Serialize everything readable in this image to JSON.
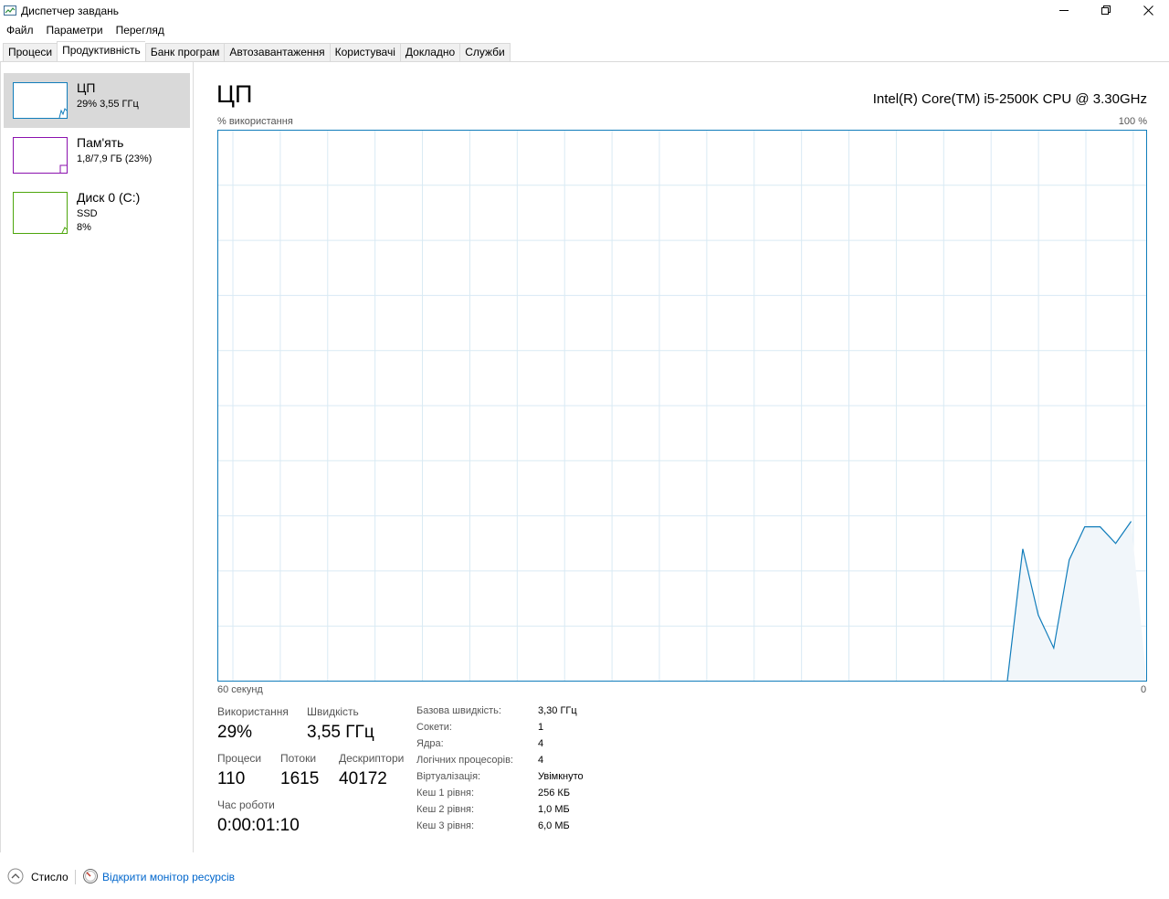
{
  "window": {
    "title": "Диспетчер завдань"
  },
  "menu": [
    "Файл",
    "Параметри",
    "Перегляд"
  ],
  "tabs": [
    "Процеси",
    "Продуктивність",
    "Банк програм",
    "Автозавантаження",
    "Користувачі",
    "Докладно",
    "Служби"
  ],
  "active_tab": "Продуктивність",
  "sidebar": {
    "items": [
      {
        "title": "ЦП",
        "line1": "29%  3,55 ГГц",
        "line2": ""
      },
      {
        "title": "Пам'ять",
        "line1": "1,8/7,9 ГБ (23%)",
        "line2": ""
      },
      {
        "title": "Диск 0 (C:)",
        "line1": "SSD",
        "line2": "8%"
      }
    ]
  },
  "main": {
    "title": "ЦП",
    "cpu_model": "Intel(R) Core(TM) i5-2500K CPU @ 3.30GHz",
    "y_axis_label": "% використання",
    "y_axis_max": "100 %",
    "x_axis_left": "60 секунд",
    "x_axis_right": "0"
  },
  "chart_data": {
    "type": "area",
    "x": [
      0,
      1,
      2,
      3,
      4,
      5,
      6,
      7,
      8,
      9,
      10,
      11,
      12,
      13,
      14,
      15,
      16,
      17,
      18,
      19,
      20,
      21,
      22,
      23,
      24,
      25,
      26,
      27,
      28,
      29,
      30,
      31,
      32,
      33,
      34,
      35,
      36,
      37,
      38,
      39,
      40,
      41,
      42,
      43,
      44,
      45,
      46,
      47,
      48,
      49,
      50,
      51,
      52,
      53,
      54,
      55,
      56,
      57,
      58,
      59,
      60
    ],
    "values": [
      0,
      0,
      0,
      0,
      0,
      0,
      0,
      0,
      0,
      0,
      0,
      0,
      0,
      0,
      0,
      0,
      0,
      0,
      0,
      0,
      0,
      0,
      0,
      0,
      0,
      0,
      0,
      0,
      0,
      0,
      0,
      0,
      0,
      0,
      0,
      0,
      0,
      0,
      0,
      0,
      0,
      0,
      0,
      0,
      0,
      0,
      0,
      0,
      0,
      0,
      0,
      0,
      24,
      12,
      6,
      22,
      28,
      28,
      25,
      29
    ],
    "ylim": [
      0,
      100
    ],
    "grid": true
  },
  "stats": {
    "usage_label": "Використання",
    "usage_value": "29%",
    "speed_label": "Швидкість",
    "speed_value": "3,55 ГГц",
    "processes_label": "Процеси",
    "processes_value": "110",
    "threads_label": "Потоки",
    "threads_value": "1615",
    "handles_label": "Дескриптори",
    "handles_value": "40172",
    "uptime_label": "Час роботи",
    "uptime_value": "0:00:01:10"
  },
  "specs": [
    {
      "label": "Базова швидкість:",
      "value": "3,30 ГГц"
    },
    {
      "label": "Сокети:",
      "value": "1"
    },
    {
      "label": "Ядра:",
      "value": "4"
    },
    {
      "label": "Логічних процесорів:",
      "value": "4"
    },
    {
      "label": "Віртуалізація:",
      "value": "Увімкнуто"
    },
    {
      "label": "Кеш 1 рівня:",
      "value": "256 КБ"
    },
    {
      "label": "Кеш 2 рівня:",
      "value": "1,0 МБ"
    },
    {
      "label": "Кеш 3 рівня:",
      "value": "6,0 МБ"
    }
  ],
  "footer": {
    "fewer_details": "Стисло",
    "resource_monitor": "Відкрити монітор ресурсів"
  },
  "colors": {
    "cpu": "#117dbb",
    "cpu_fill": "#f1f6fa",
    "grid": "#d9eaf4",
    "memory": "#8b12ae",
    "disk": "#4da60c"
  }
}
